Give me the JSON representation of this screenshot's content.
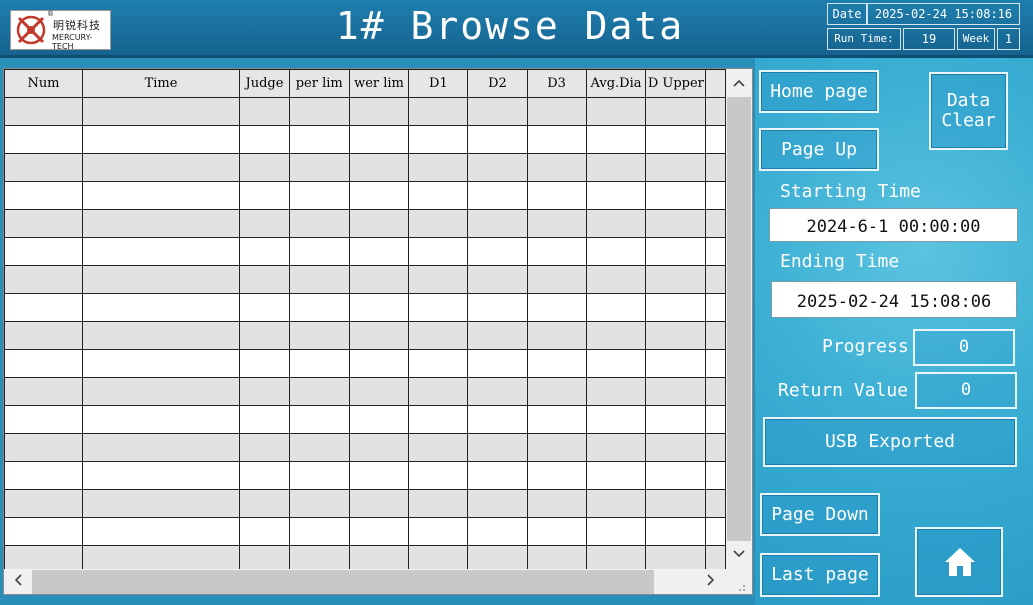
{
  "header": {
    "title": "1# Browse Data",
    "logo_cn": "明锐科技",
    "logo_en": "MERCURY-TECH",
    "logo_reg": "®",
    "date_label": "Date",
    "date_value": "2025-02-24 15:08:16",
    "run_time_label": "Run Time:",
    "run_time_value": "19",
    "week_label": "Week",
    "week_value": "1"
  },
  "table": {
    "columns": [
      "Num",
      "Time",
      "Judge",
      "per lim",
      "wer lim",
      "D1",
      "D2",
      "D3",
      "Avg.Dia",
      "D Upper"
    ],
    "row_count": 17
  },
  "scroll": {
    "up_arrow": "^",
    "down_arrow": "v",
    "left_arrow": "<",
    "right_arrow": ">"
  },
  "panel": {
    "home_page_label": "Home page",
    "data_clear_label": "Data\nClear",
    "page_up_label": "Page Up",
    "starting_time_label": "Starting Time",
    "starting_time_value": "2024-6-1 00:00:00",
    "ending_time_label": "Ending Time",
    "ending_time_value": "2025-02-24 15:08:06",
    "progress_label": "Progress",
    "progress_value": "0",
    "return_value_label": "Return Value",
    "return_value_value": "0",
    "usb_exported_label": "USB Exported",
    "page_down_label": "Page Down",
    "last_page_label": "Last page",
    "home_icon": "home-icon"
  }
}
